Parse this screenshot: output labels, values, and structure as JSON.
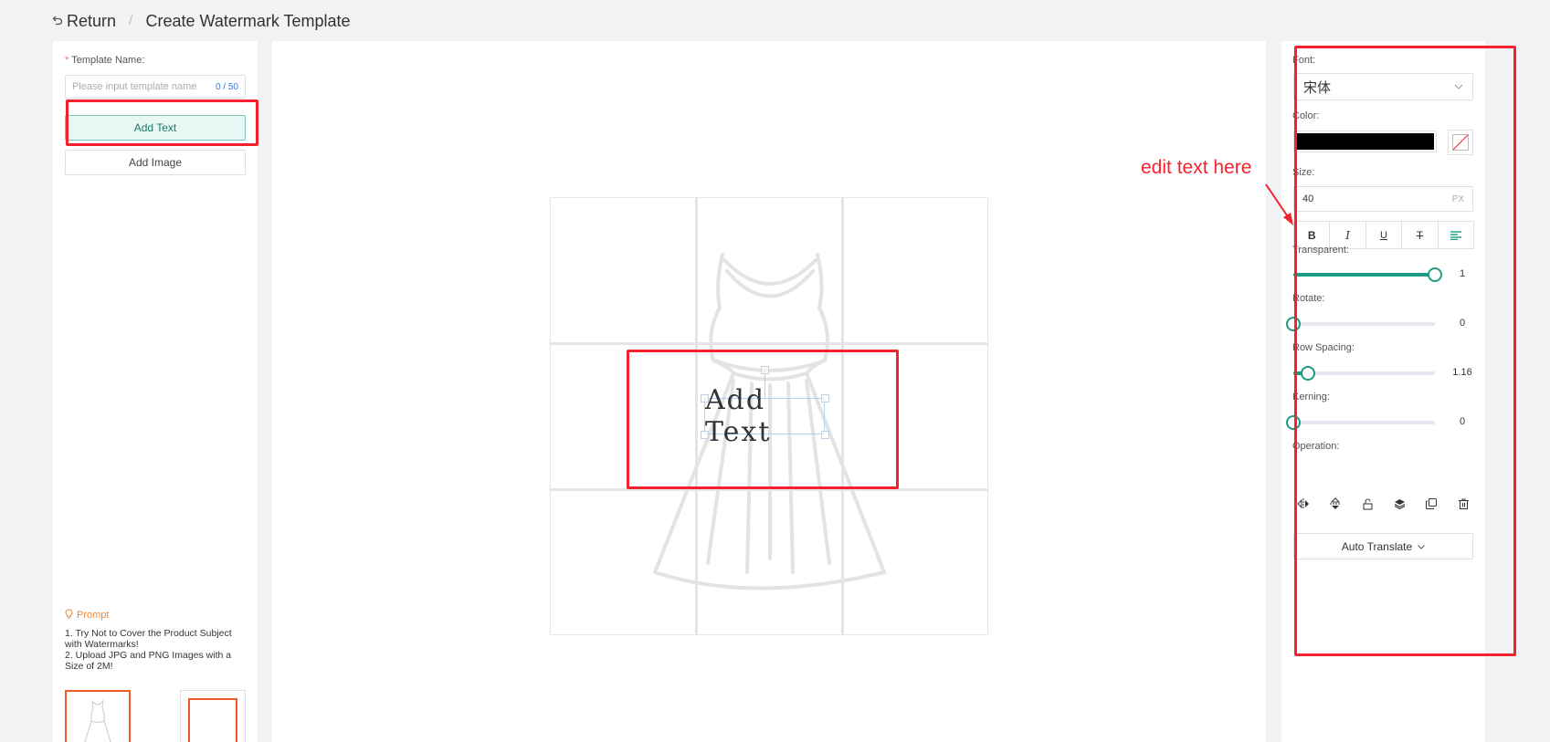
{
  "header": {
    "back_icon": "return-icon",
    "back_label": "Return",
    "separator": "/",
    "title": "Create Watermark Template"
  },
  "left": {
    "template_name_label": "Template Name:",
    "required_mark": "*",
    "template_name_placeholder": "Please input template name",
    "char_count": "0 / 50",
    "add_text_label": "Add Text",
    "add_image_label": "Add Image",
    "prompt_title": "Prompt",
    "prompt_line1": "1. Try Not to Cover the Product Subject with Watermarks!",
    "prompt_line2": "2. Upload JPG and PNG Images with a Size of 2M!"
  },
  "canvas": {
    "watermark_text": "Add Text"
  },
  "right": {
    "font_label": "Font:",
    "font_value": "宋体",
    "color_label": "Color:",
    "color_value": "#000000",
    "size_label": "Size:",
    "size_value": "40",
    "size_unit": "PX",
    "format_buttons": [
      "B",
      "I",
      "U",
      "T"
    ],
    "transparent_label": "Transparent:",
    "transparent_value": "1",
    "transparent_fraction": 1,
    "rotate_label": "Rotate:",
    "rotate_value": "0",
    "rotate_fraction": 0,
    "row_spacing_label": "Row Spacing:",
    "row_spacing_value": "1.16",
    "row_spacing_fraction": 0.1,
    "kerning_label": "Kerning:",
    "kerning_value": "0",
    "kerning_fraction": 0,
    "operation_label": "Operation:",
    "auto_translate_label": "Auto Translate"
  },
  "annotation": {
    "text": "edit text here",
    "color": "#f5222d"
  },
  "colors": {
    "accent": "#1c9a82",
    "annotation": "#f5222d",
    "thumb_border": "#ee5a2a"
  }
}
